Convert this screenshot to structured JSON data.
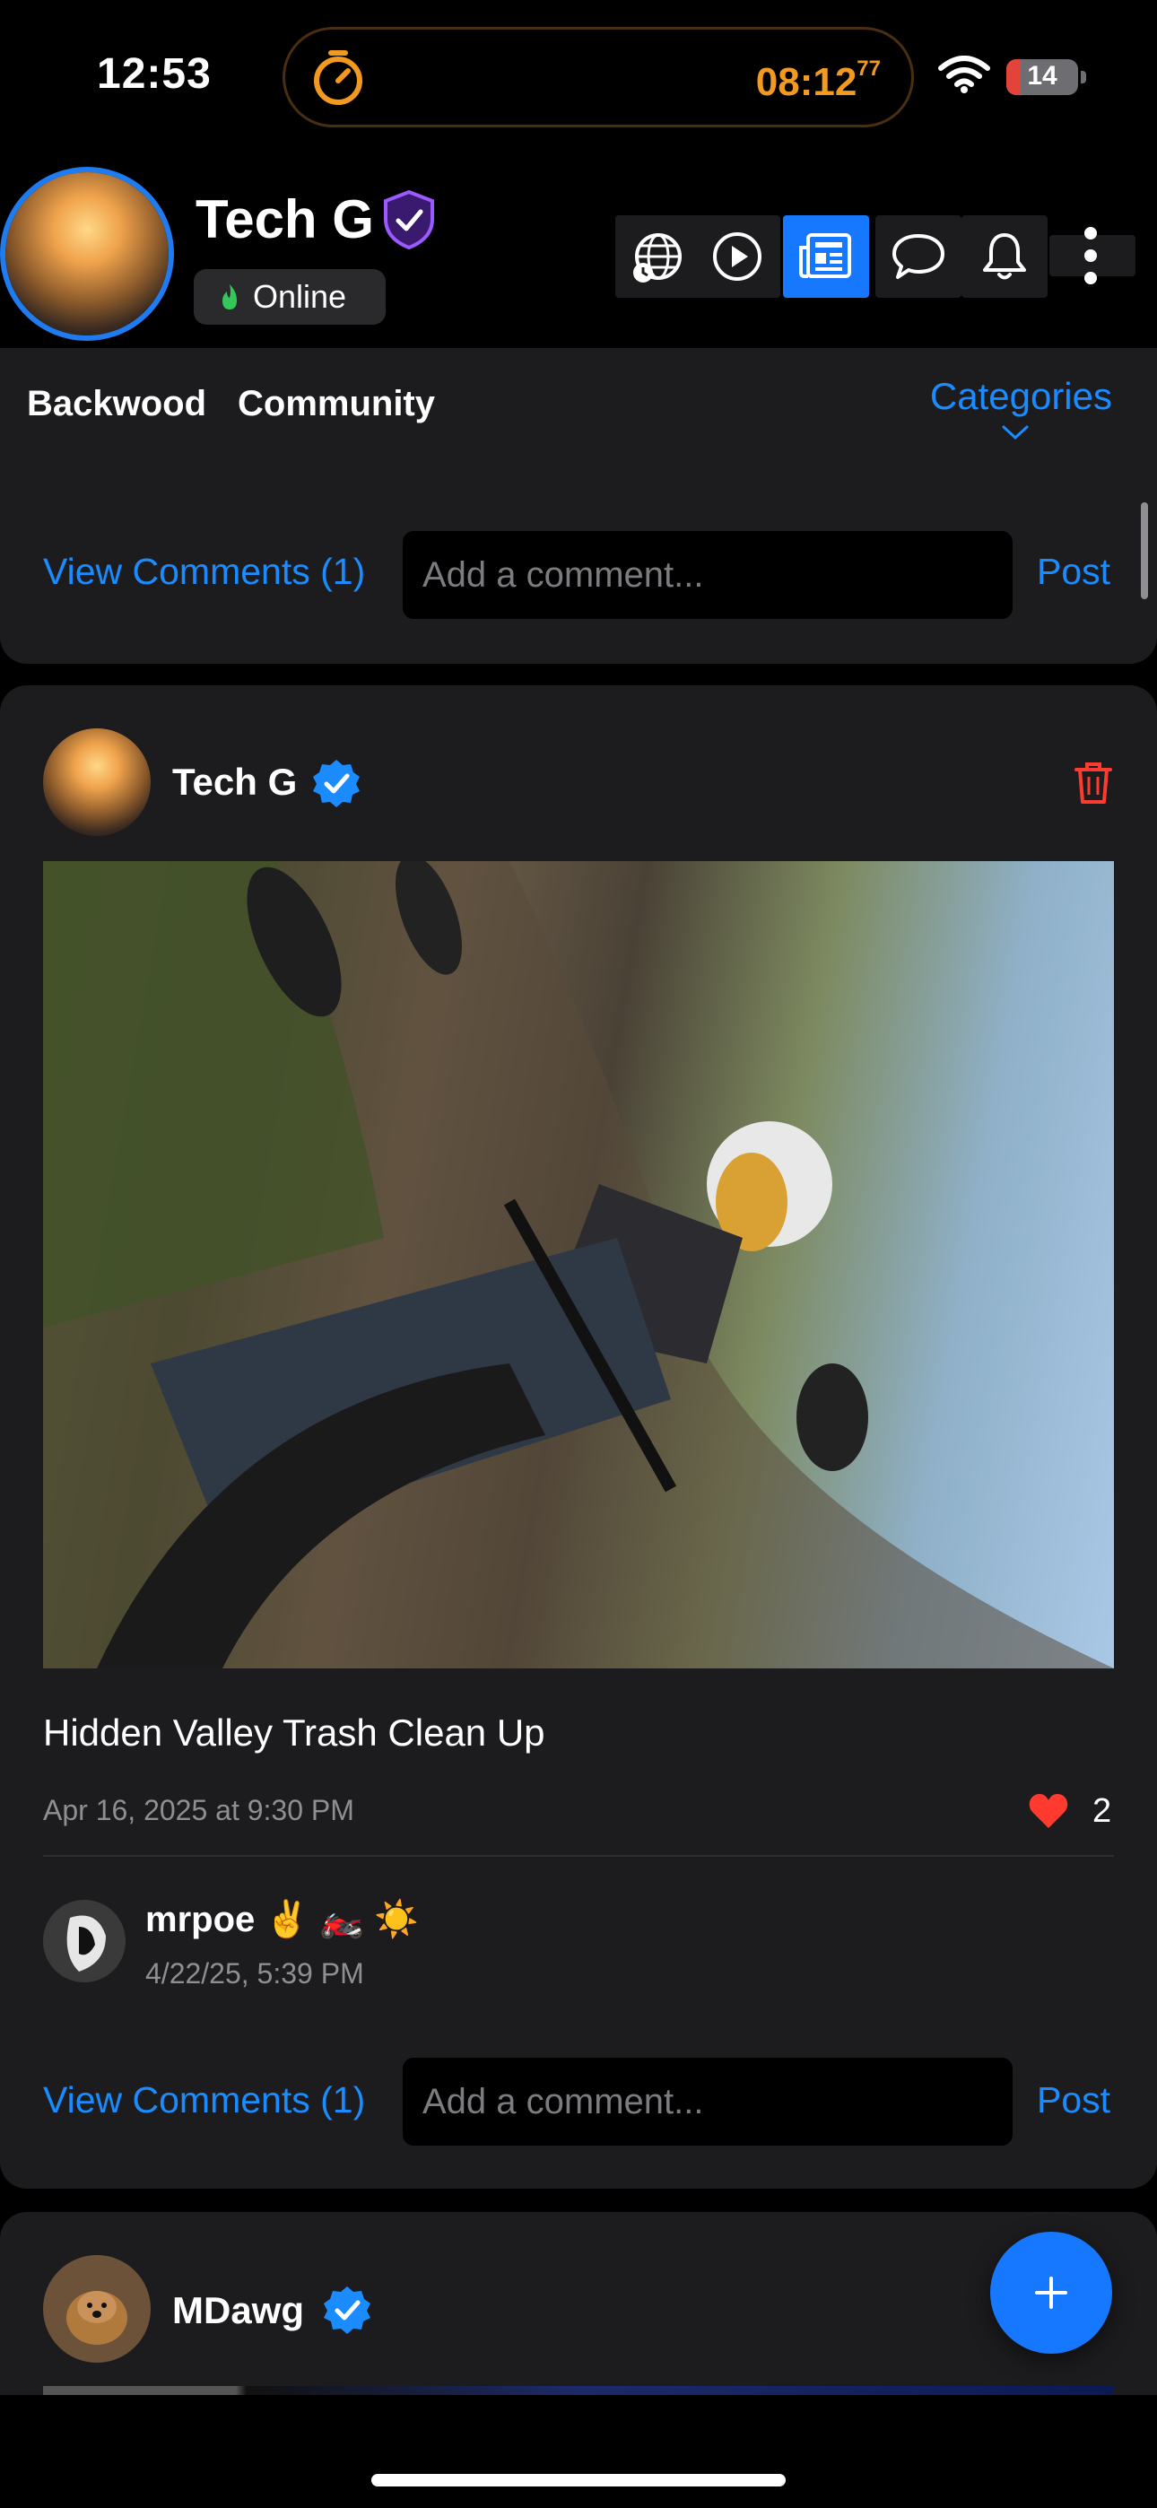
{
  "status_bar": {
    "time": "12:53",
    "timer": "08:12",
    "timer_fraction": "77",
    "battery": "14"
  },
  "header": {
    "name": "Tech G",
    "status": "Online"
  },
  "nav_icons": [
    "globe-icon",
    "play-icon",
    "news-icon",
    "chat-icon",
    "bell-icon",
    "more-icon"
  ],
  "categories": {
    "items": [
      "Backwood",
      "Community"
    ],
    "toggle": "Categories"
  },
  "prev_card": {
    "view_comments": "View Comments (1)",
    "comment_placeholder": "Add a comment...",
    "post_label": "Post"
  },
  "post": {
    "author": "Tech G",
    "caption": "Hidden Valley Trash Clean Up",
    "date": "Apr 16, 2025 at 9:30 PM",
    "likes": "2",
    "comment": {
      "author": "mrpoe ✌️ 🏍️ ☀️",
      "time": "4/22/25, 5:39 PM"
    },
    "view_comments": "View Comments (1)",
    "comment_placeholder": "Add a comment...",
    "post_label": "Post"
  },
  "next_post": {
    "author": "MDawg"
  },
  "colors": {
    "accent": "#1677ff",
    "link": "#1a8cff",
    "timer": "#f29a1f",
    "like": "#ff3b30"
  }
}
